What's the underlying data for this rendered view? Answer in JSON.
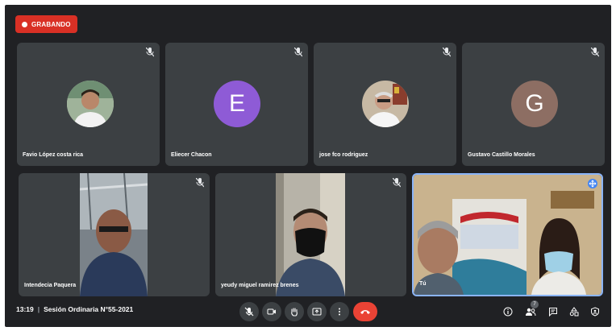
{
  "recording": {
    "label": "GRABANDO"
  },
  "participants": [
    {
      "name": "Favio López costa rica"
    },
    {
      "name": "Eliecer Chacon",
      "initial": "E",
      "color": "#8e5bd6"
    },
    {
      "name": "jose fco rodriguez"
    },
    {
      "name": "Gustavo Castillo Morales",
      "initial": "G",
      "color": "#8d6e63"
    },
    {
      "name": "Intendecia Paquera"
    },
    {
      "name": "yeudy miguel ramirez brenes"
    },
    {
      "name": "Tú"
    }
  ],
  "meeting": {
    "time": "13:19",
    "separator": "|",
    "title": "Sesión Ordinaria N°55-2021"
  },
  "people_count": "7",
  "colors": {
    "background": "#202124",
    "tile": "#3c4043",
    "recording": "#d93025",
    "end_call": "#ea4335",
    "active_border": "#8ab4f8"
  },
  "icons": [
    "mic-muted-icon",
    "camera-icon",
    "raise-hand-icon",
    "present-icon",
    "more-options-icon",
    "end-call-icon",
    "info-icon",
    "people-icon",
    "chat-icon",
    "activities-icon",
    "host-controls-icon"
  ]
}
